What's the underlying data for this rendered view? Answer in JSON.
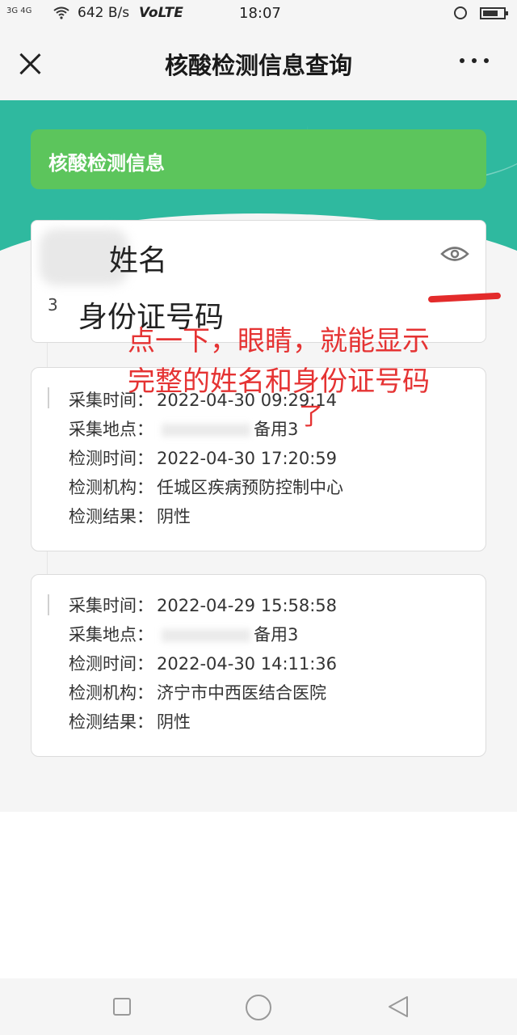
{
  "status_bar": {
    "signal_text": "3G 4G",
    "speed": "642 B/s",
    "network": "VoLTE",
    "time": "18:07"
  },
  "nav": {
    "title": "核酸检测信息查询"
  },
  "header_card": {
    "title": "核酸检测信息"
  },
  "identity": {
    "name": "姓名",
    "id_prefix": "3",
    "id_number": "身份证号码"
  },
  "annotation": {
    "line1": "点一下，眼睛，就能显示",
    "line2": "完整的姓名和身份证号码",
    "tail": "了"
  },
  "records": [
    {
      "rows": [
        {
          "key": "采集时间：",
          "value": "2022-04-30 09:29:14"
        },
        {
          "key": "采集地点：",
          "value": "备用3",
          "redacted": true
        },
        {
          "key": "检测时间：",
          "value": "2022-04-30 17:20:59"
        },
        {
          "key": "检测机构：",
          "value": "任城区疾病预防控制中心"
        },
        {
          "key": "检测结果：",
          "value": "阴性"
        }
      ]
    },
    {
      "rows": [
        {
          "key": "采集时间：",
          "value": "2022-04-29 15:58:58"
        },
        {
          "key": "采集地点：",
          "value": "备用3",
          "redacted": true
        },
        {
          "key": "检测时间：",
          "value": "2022-04-30 14:11:36"
        },
        {
          "key": "检测机构：",
          "value": "济宁市中西医结合医院"
        },
        {
          "key": "检测结果：",
          "value": "阴性"
        }
      ]
    }
  ],
  "colors": {
    "teal": "#2fb99f",
    "green": "#5cc55c",
    "annotation_red": "#e53333"
  }
}
